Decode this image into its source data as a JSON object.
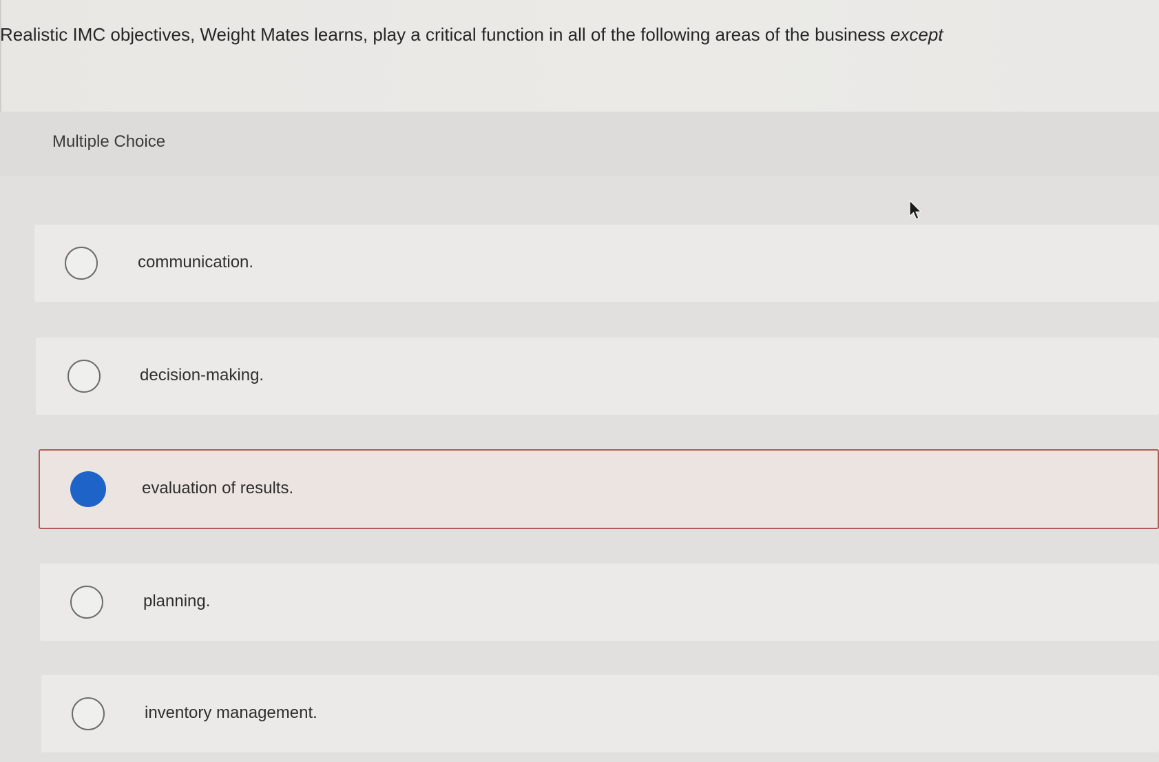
{
  "question": {
    "text_main": "Realistic IMC objectives, Weight Mates learns, play a critical function in all of the following areas of the business ",
    "text_emphasis": "except"
  },
  "section": {
    "label": "Multiple Choice"
  },
  "choices": [
    {
      "label": "communication.",
      "selected": false
    },
    {
      "label": "decision-making.",
      "selected": false
    },
    {
      "label": "evaluation of results.",
      "selected": true
    },
    {
      "label": "planning.",
      "selected": false
    },
    {
      "label": "inventory management.",
      "selected": false
    }
  ],
  "colors": {
    "selected_radio": "#1e64c8",
    "selected_border": "#b45a55",
    "selected_background": "#ece4e0"
  },
  "icons": {
    "cursor": "mouse-pointer-icon"
  }
}
